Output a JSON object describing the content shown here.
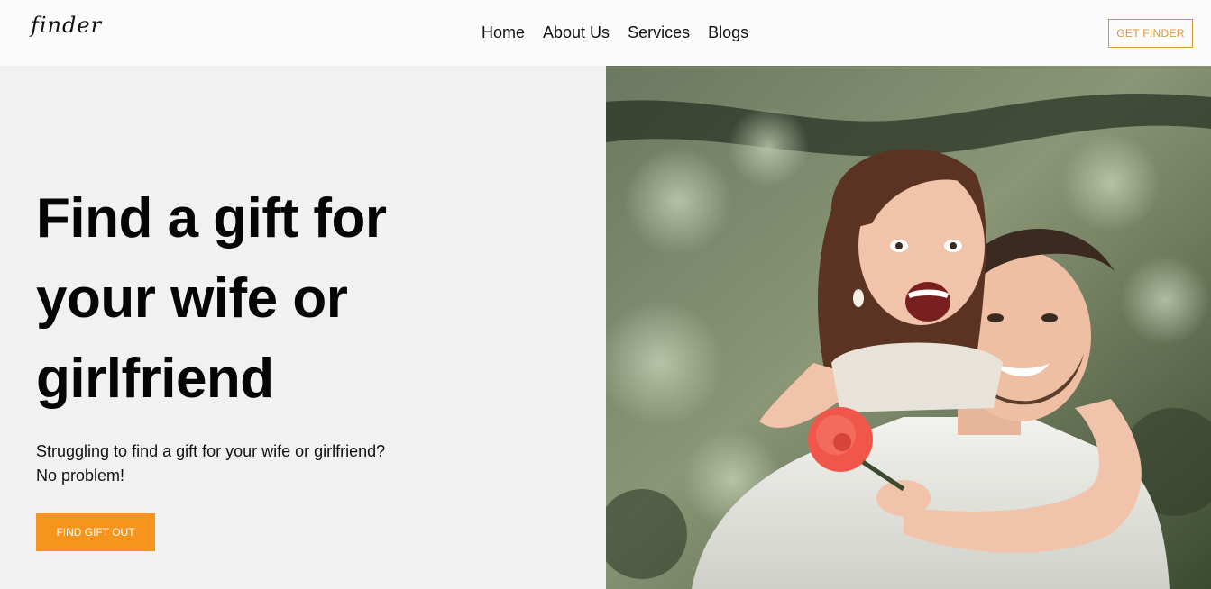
{
  "brand": {
    "logo_text": "finder"
  },
  "nav": {
    "links": [
      "Home",
      "About Us",
      "Services",
      "Blogs"
    ],
    "cta_label": "GET FINDER"
  },
  "hero": {
    "headline_lines": [
      "Find a gift for",
      "your wife or",
      "girlfriend"
    ],
    "subtext_lines": [
      "Struggling to find a gift for your wife or girlfriend?",
      "No problem!"
    ],
    "button_label": "FIND GIFT OUT",
    "image_alt_name": "couple-photo"
  },
  "colors": {
    "accent": "#f7941d",
    "nav_cta_border": "#d59a3a",
    "background": "#f1f1f1",
    "navbar_bg": "#fbfbfb",
    "text": "#111111"
  }
}
